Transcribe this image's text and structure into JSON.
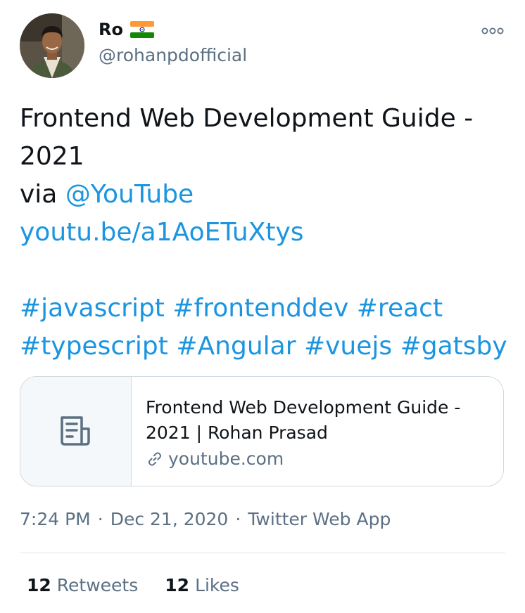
{
  "author": {
    "name": "Ro",
    "handle": "@rohanpdofficial",
    "flag_icon": "india-flag-icon"
  },
  "tweet": {
    "line1": "Frontend Web Development Guide -",
    "line2": "2021",
    "via_prefix": "via ",
    "mention": "@YouTube",
    "url": "youtu.be/a1AoETuXtys",
    "hashtags_line1": [
      "#javascript",
      "#frontenddev",
      "#react"
    ],
    "hashtags_line2": [
      "#typescript",
      "#Angular",
      "#vuejs",
      "#gatsby"
    ]
  },
  "card": {
    "title": "Frontend Web Development Guide - 2021 | Rohan Prasad",
    "domain": "youtube.com",
    "thumb_icon": "document-icon",
    "domain_icon": "link-icon"
  },
  "meta": {
    "time": "7:24 PM",
    "separator": "·",
    "date": "Dec 21, 2020",
    "source": "Twitter Web App"
  },
  "stats": {
    "retweets_count": "12",
    "retweets_label": "Retweets",
    "likes_count": "12",
    "likes_label": "Likes"
  },
  "colors": {
    "link": "#1b95e0",
    "text": "#0f1419",
    "secondary": "#5b7083",
    "border": "#cfd9de"
  }
}
